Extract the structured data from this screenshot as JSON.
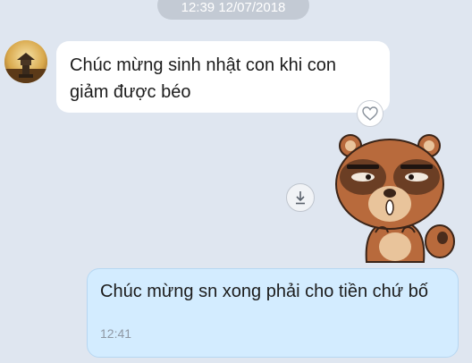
{
  "chat": {
    "date_separator": "12:39 12/07/2018",
    "messages": [
      {
        "direction": "incoming",
        "text": "Chúc mừng sinh nhật con khi con giảm được béo"
      },
      {
        "direction": "incoming",
        "type": "sticker",
        "sticker_icon": "bear-sticker"
      },
      {
        "direction": "outgoing",
        "text": "Chúc mừng sn xong phải cho tiền chứ bố",
        "time": "12:41"
      }
    ]
  },
  "icons": {
    "like": "heart-icon",
    "download": "download-icon"
  },
  "colors": {
    "background": "#dfe6f0",
    "incoming_bubble": "#ffffff",
    "outgoing_bubble": "#d3ecff",
    "outgoing_border": "#b6d7f2",
    "timestamp_pill": "#c3cad4"
  }
}
